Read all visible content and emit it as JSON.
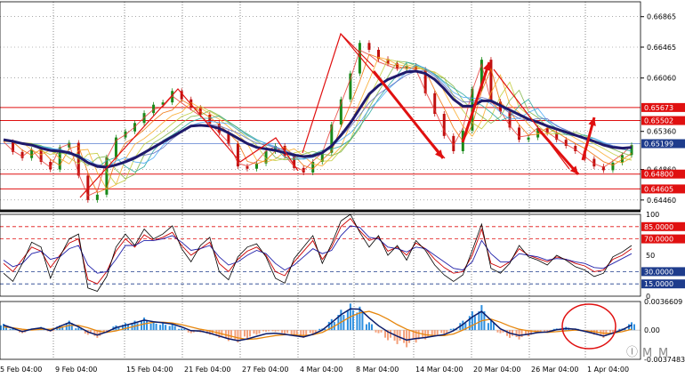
{
  "chart_data": [
    {
      "type": "line",
      "panel": "price",
      "ylim": [
        0.6433,
        0.6706
      ],
      "y_ticks": [
        "0.66865",
        "0.66465",
        "0.66060",
        "0.65360",
        "0.64860",
        "0.64460"
      ],
      "x_tick_labels": [
        "5 Feb 04:00",
        "9 Feb 04:00",
        "15 Feb 04:00",
        "21 Feb 04:00",
        "27 Feb 04:00",
        "4 Mar 04:00",
        "8 Mar 04:00",
        "14 Mar 04:00",
        "20 Mar 04:00",
        "26 Mar 04:00",
        "1 Apr 04:00"
      ],
      "current_price": {
        "value": 0.65199,
        "label": "0.65199",
        "color": "#1e3c8c"
      },
      "horizontal_levels": [
        {
          "value": 0.65673,
          "label": "0.65673",
          "color": "#e01010"
        },
        {
          "value": 0.65502,
          "label": "0.65502",
          "color": "#e01010"
        },
        {
          "value": 0.648,
          "label": "0.64800",
          "color": "#e01010"
        },
        {
          "value": 0.64605,
          "label": "0.64605",
          "color": "#e01010"
        }
      ],
      "series": [
        {
          "values": [
            0.6522,
            0.6509,
            0.6501,
            0.6512,
            0.6496,
            0.6486,
            0.6515,
            0.6521,
            0.6478,
            0.6446,
            0.6453,
            0.6502,
            0.6528,
            0.6536,
            0.6547,
            0.656,
            0.6571,
            0.6574,
            0.6589,
            0.6578,
            0.6567,
            0.6558,
            0.6546,
            0.6534,
            0.652,
            0.649,
            0.6487,
            0.6494,
            0.651,
            0.6517,
            0.6504,
            0.6488,
            0.6482,
            0.6496,
            0.6508,
            0.6545,
            0.6578,
            0.6612,
            0.6652,
            0.6643,
            0.6631,
            0.6625,
            0.6619,
            0.6622,
            0.6617,
            0.6586,
            0.6559,
            0.653,
            0.651,
            0.6537,
            0.6592,
            0.663,
            0.6575,
            0.6562,
            0.6541,
            0.6525,
            0.6528,
            0.654,
            0.6534,
            0.6525,
            0.6517,
            0.651,
            0.65,
            0.649,
            0.6485,
            0.6495,
            0.6505,
            0.6518
          ]
        },
        {
          "values": [
            0.6525,
            0.6523,
            0.652,
            0.6518,
            0.6514,
            0.6511,
            0.651,
            0.6508,
            0.6503,
            0.6495,
            0.649,
            0.6489,
            0.6492,
            0.6496,
            0.6501,
            0.6508,
            0.6515,
            0.6522,
            0.6529,
            0.6536,
            0.6543,
            0.6544,
            0.6543,
            0.654,
            0.6534,
            0.6527,
            0.652,
            0.6515,
            0.6513,
            0.6511,
            0.6508,
            0.6505,
            0.6503,
            0.6504,
            0.6508,
            0.6517,
            0.6531,
            0.6547,
            0.6566,
            0.6585,
            0.6596,
            0.6604,
            0.6609,
            0.6614,
            0.6615,
            0.6612,
            0.6604,
            0.6592,
            0.6578,
            0.6569,
            0.6569,
            0.6576,
            0.6576,
            0.657,
            0.6564,
            0.6558,
            0.6552,
            0.6548,
            0.6543,
            0.6539,
            0.6535,
            0.6531,
            0.6527,
            0.6523,
            0.6518,
            0.6515,
            0.6514,
            0.6515
          ]
        }
      ]
    },
    {
      "type": "line",
      "panel": "stochastic",
      "ylim": [
        0,
        100
      ],
      "y_ticks": [
        "100",
        "50",
        "0"
      ],
      "horizontal_levels": [
        {
          "value": 85,
          "label": "85.0000",
          "color": "#e01010"
        },
        {
          "value": 70,
          "label": "70.0000",
          "color": "#e01010"
        },
        {
          "value": 30,
          "label": "30.0000",
          "color": "#1e3c8c"
        },
        {
          "value": 15,
          "label": "15.0000",
          "color": "#1e3c8c"
        }
      ],
      "series": [
        {
          "values": [
            40,
            30,
            45,
            60,
            55,
            35,
            50,
            65,
            70,
            20,
            15,
            30,
            55,
            70,
            60,
            75,
            68,
            72,
            78,
            62,
            50,
            58,
            66,
            40,
            30,
            45,
            55,
            60,
            50,
            30,
            25,
            42,
            55,
            68,
            45,
            60,
            85,
            95,
            80,
            68,
            72,
            55,
            60,
            50,
            65,
            58,
            45,
            35,
            28,
            30,
            50,
            82,
            40,
            35,
            42,
            58,
            50,
            46,
            42,
            48,
            45,
            40,
            37,
            30,
            32,
            45,
            50,
            58
          ]
        },
        {
          "values": [
            44,
            36,
            40,
            52,
            55,
            45,
            48,
            58,
            62,
            38,
            28,
            30,
            45,
            62,
            62,
            68,
            68,
            70,
            74,
            66,
            56,
            58,
            62,
            48,
            38,
            42,
            50,
            56,
            52,
            40,
            32,
            38,
            48,
            58,
            52,
            56,
            74,
            86,
            84,
            72,
            70,
            60,
            58,
            54,
            60,
            58,
            50,
            42,
            34,
            32,
            42,
            68,
            52,
            42,
            42,
            52,
            50,
            48,
            44,
            46,
            45,
            42,
            40,
            35,
            34,
            40,
            46,
            52
          ]
        },
        {
          "values": [
            28,
            18,
            40,
            66,
            60,
            22,
            48,
            70,
            76,
            10,
            6,
            24,
            60,
            76,
            62,
            82,
            70,
            76,
            86,
            58,
            42,
            62,
            72,
            30,
            20,
            48,
            60,
            64,
            48,
            22,
            16,
            46,
            60,
            74,
            40,
            64,
            92,
            100,
            78,
            60,
            74,
            50,
            62,
            44,
            68,
            56,
            38,
            26,
            18,
            26,
            56,
            88,
            34,
            28,
            40,
            62,
            48,
            44,
            38,
            50,
            44,
            36,
            32,
            24,
            28,
            48,
            54,
            62
          ]
        }
      ]
    },
    {
      "type": "bar",
      "panel": "oscillator",
      "ylim": [
        -0.0037483,
        0.0036609
      ],
      "y_ticks": [
        "0.0036609",
        "0.00",
        "-0.0037483"
      ],
      "series": [
        {
          "values": [
            0.0008,
            0.0002,
            -0.0004,
            0.0002,
            0.0004,
            -0.0002,
            0.0006,
            0.0012,
            0.0003,
            -0.0006,
            -0.001,
            -0.0002,
            0.0006,
            0.0009,
            0.0012,
            0.0016,
            0.0011,
            0.0009,
            0.0007,
            0.0002,
            -0.0004,
            -0.0003,
            -0.0006,
            -0.001,
            -0.0014,
            -0.0016,
            -0.0011,
            -0.0006,
            -0.0002,
            -0.0002,
            -0.0005,
            -0.0008,
            -0.001,
            -0.0005,
            0.0002,
            0.0014,
            0.0026,
            0.0034,
            0.003,
            0.001,
            -0.0004,
            -0.0013,
            -0.0018,
            -0.0022,
            -0.0016,
            -0.0012,
            -0.0008,
            -0.0005,
            0.0002,
            0.0012,
            0.0024,
            0.0032,
            0.0012,
            -0.0004,
            -0.001,
            -0.0012,
            -0.0008,
            -0.0004,
            -0.0002,
            0.0002,
            0.0004,
            0.0002,
            -0.0002,
            -0.0006,
            -0.001,
            -0.0004,
            0.0002,
            0.001
          ]
        },
        {
          "values": [
            0.0004,
            0.0003,
            0.0001,
            0.0,
            0.0001,
            0.0001,
            0.0003,
            0.0006,
            0.0006,
            0.0003,
            -0.0001,
            -0.0003,
            -0.0001,
            0.0002,
            0.0005,
            0.0008,
            0.001,
            0.001,
            0.0009,
            0.0007,
            0.0004,
            0.0001,
            -0.0001,
            -0.0004,
            -0.0007,
            -0.001,
            -0.0012,
            -0.0011,
            -0.0009,
            -0.0007,
            -0.0006,
            -0.0006,
            -0.0007,
            -0.0006,
            -0.0003,
            0.0003,
            0.001,
            0.0017,
            0.0022,
            0.0024,
            0.002,
            0.0014,
            0.0007,
            0.0001,
            -0.0003,
            -0.0006,
            -0.0007,
            -0.0007,
            -0.0005,
            0.0,
            0.0006,
            0.0012,
            0.0014,
            0.001,
            0.0005,
            0.0001,
            -0.0001,
            -0.0002,
            -0.0003,
            -0.0002,
            -0.0001,
            0.0,
            -0.0001,
            -0.0002,
            -0.0004,
            -0.0004,
            -0.0002,
            0.0001
          ]
        }
      ]
    }
  ]
}
